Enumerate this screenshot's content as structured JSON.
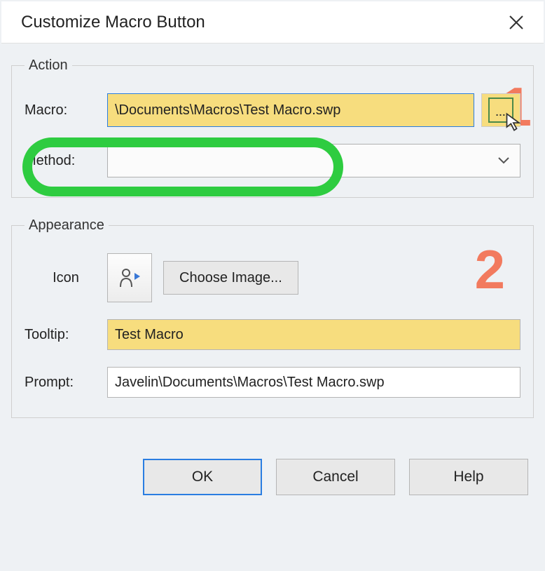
{
  "title": "Customize Macro Button",
  "action": {
    "legend": "Action",
    "macro_label": "Macro:",
    "macro_value": "\\Documents\\Macros\\Test Macro.swp",
    "method_label": "Method:",
    "method_value": ""
  },
  "appearance": {
    "legend": "Appearance",
    "icon_label": "Icon",
    "choose_image_label": "Choose Image...",
    "tooltip_label": "Tooltip:",
    "tooltip_value": "Test Macro",
    "prompt_label": "Prompt:",
    "prompt_value": "Javelin\\Documents\\Macros\\Test Macro.swp"
  },
  "buttons": {
    "ok": "OK",
    "cancel": "Cancel",
    "help": "Help"
  },
  "annotations": {
    "one": "1",
    "two": "2"
  }
}
